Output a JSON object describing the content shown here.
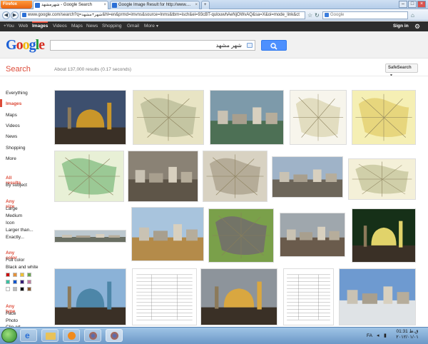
{
  "browser": {
    "firefox_label": "Firefox",
    "tabs": [
      {
        "label": "شهرمشهد - Google Search"
      },
      {
        "label": "Google Image Result for http://www...."
      }
    ],
    "new_tab": "+",
    "url": "www.google.com/search?q=شهر+مشهد&hl=en&prmd=imvns&source=lnms&tbm=isch&ei=93cBT-qulouwhAeNjOWvAQ&sa=X&oi=mode_link&ct",
    "search_placeholder": "Google"
  },
  "gbar": {
    "items": [
      "+You",
      "Web",
      "Images",
      "Videos",
      "Maps",
      "News",
      "Shopping",
      "Gmail",
      "More"
    ],
    "selected": "Images",
    "signin": "Sign in"
  },
  "logo": "Google",
  "query": "شهر مشهد",
  "search_heading": "Search",
  "stats": "About 137,000 results (0.17 seconds)",
  "safesearch": "SafeSearch",
  "left": {
    "types": [
      "Everything",
      "Images",
      "Maps",
      "Videos",
      "News",
      "Shopping",
      "More"
    ],
    "selected_type": "Images",
    "results_header": "All results",
    "results_sub": "By subject",
    "size_header": "Any size",
    "sizes": [
      "Large",
      "Medium",
      "Icon",
      "Larger than...",
      "Exactly..."
    ],
    "color_header": "Any color",
    "colors": [
      "Full color",
      "Black and white"
    ],
    "swatches": [
      "#cc0000",
      "#e69138",
      "#f1c232",
      "#6aa84f",
      "#38c2a2",
      "#1155cc",
      "#351c75",
      "#c27ba0",
      "#ffffff",
      "#bbbbbb",
      "#000000",
      "#8b5a2b"
    ],
    "type_header": "Any type",
    "types2": [
      "Face",
      "Photo",
      "Clip art"
    ]
  },
  "images": [
    {
      "name": "shrine-dome-night"
    },
    {
      "name": "city-map-1"
    },
    {
      "name": "aerial-park"
    },
    {
      "name": "map-sketch"
    },
    {
      "name": "yellow-map"
    },
    {
      "name": "green-map"
    },
    {
      "name": "old-city"
    },
    {
      "name": "satellite-map"
    },
    {
      "name": "monument-square"
    },
    {
      "name": "street-map"
    },
    {
      "name": "panorama"
    },
    {
      "name": "construction-cranes"
    },
    {
      "name": "purple-map"
    },
    {
      "name": "city-view"
    },
    {
      "name": "shrine-night-green"
    },
    {
      "name": "shrine-blue-dome"
    },
    {
      "name": "table-document"
    },
    {
      "name": "shrine-snow"
    },
    {
      "name": "list-document"
    },
    {
      "name": "monorail"
    }
  ],
  "taskbar": {
    "lang": "FA",
    "time": "01:31 ق.ظ",
    "date": "۲۰۱۲/۰۱/۰۱"
  }
}
